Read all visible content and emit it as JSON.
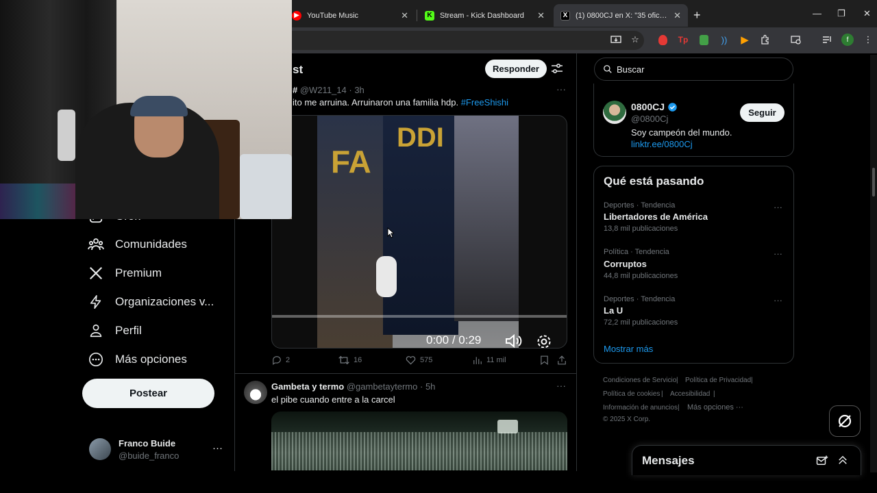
{
  "browser": {
    "tabs": [
      {
        "title": "YouTube Music",
        "close": "✕",
        "active": false
      },
      {
        "title": "Stream - Kick Dashboard",
        "close": "✕",
        "active": false
      },
      {
        "title": "(1) 0800CJ en X: \"35 oficiales pa",
        "close": "✕",
        "active": true
      }
    ],
    "new_tab": "+",
    "window_controls": [
      "—",
      "❐",
      "✕"
    ]
  },
  "sidebar": {
    "items": [
      {
        "label": "Grok",
        "icon": "grok-icon"
      },
      {
        "label": "Comunidades",
        "icon": "communities-icon"
      },
      {
        "label": "Premium",
        "icon": "x-logo-icon"
      },
      {
        "label": "Organizaciones v...",
        "icon": "lightning-icon"
      },
      {
        "label": "Perfil",
        "icon": "person-icon"
      },
      {
        "label": "Más opciones",
        "icon": "more-circle-icon"
      }
    ],
    "post_label": "Postear",
    "account": {
      "name": "Franco Buide",
      "handle": "@buide_franco",
      "more": "···"
    }
  },
  "main": {
    "title": "Post",
    "title_partial": "st",
    "reply_label": "Responder",
    "tweet1": {
      "author_partial": "#",
      "handle": "@W211_14",
      "time": "3h",
      "text_before": "ito me arruina. Arruinaron una familia hdp. ",
      "hashtag": "#FreeShishi",
      "video": {
        "current": "0:00",
        "separator": "/",
        "duration": "0:29",
        "overlay_text_1": "FA",
        "overlay_text_2": "DDI"
      },
      "stats": {
        "replies": "2",
        "reposts": "16",
        "likes": "575",
        "views": "11 mil"
      }
    },
    "tweet2": {
      "author": "Gambeta y termo",
      "handle": "@gambetaytermo",
      "time": "5h",
      "text": "el pibe cuando entre a la carcel"
    }
  },
  "right": {
    "search_placeholder": "Buscar",
    "relevant": {
      "name": "0800CJ",
      "handle": "@0800Cj",
      "bio": "Soy campeón del mundo.",
      "link": "linktr.ee/0800Cj",
      "follow_label": "Seguir"
    },
    "trends_title": "Qué está pasando",
    "trends": [
      {
        "category": "Deportes · Tendencia",
        "name": "Libertadores de América",
        "count": "13,8 mil publicaciones"
      },
      {
        "category": "Política · Tendencia",
        "name": "Corruptos",
        "count": "44,8 mil publicaciones"
      },
      {
        "category": "Deportes · Tendencia",
        "name": "La U",
        "count": "72,2 mil publicaciones"
      }
    ],
    "show_more": "Mostrar más",
    "footer": {
      "terms": "Condiciones de Servicio",
      "privacy": "Política de Privacidad",
      "cookies": "Política de cookies",
      "accessibility": "Accesibilidad",
      "ads": "Información de anuncios",
      "more": "Más opciones ···",
      "copyright": "© 2025 X Corp."
    },
    "messages_title": "Mensajes"
  },
  "colors": {
    "accent": "#1d9bf0",
    "background": "#000000",
    "text": "#e7e9ea",
    "muted": "#71767b",
    "border": "#2f3336"
  }
}
